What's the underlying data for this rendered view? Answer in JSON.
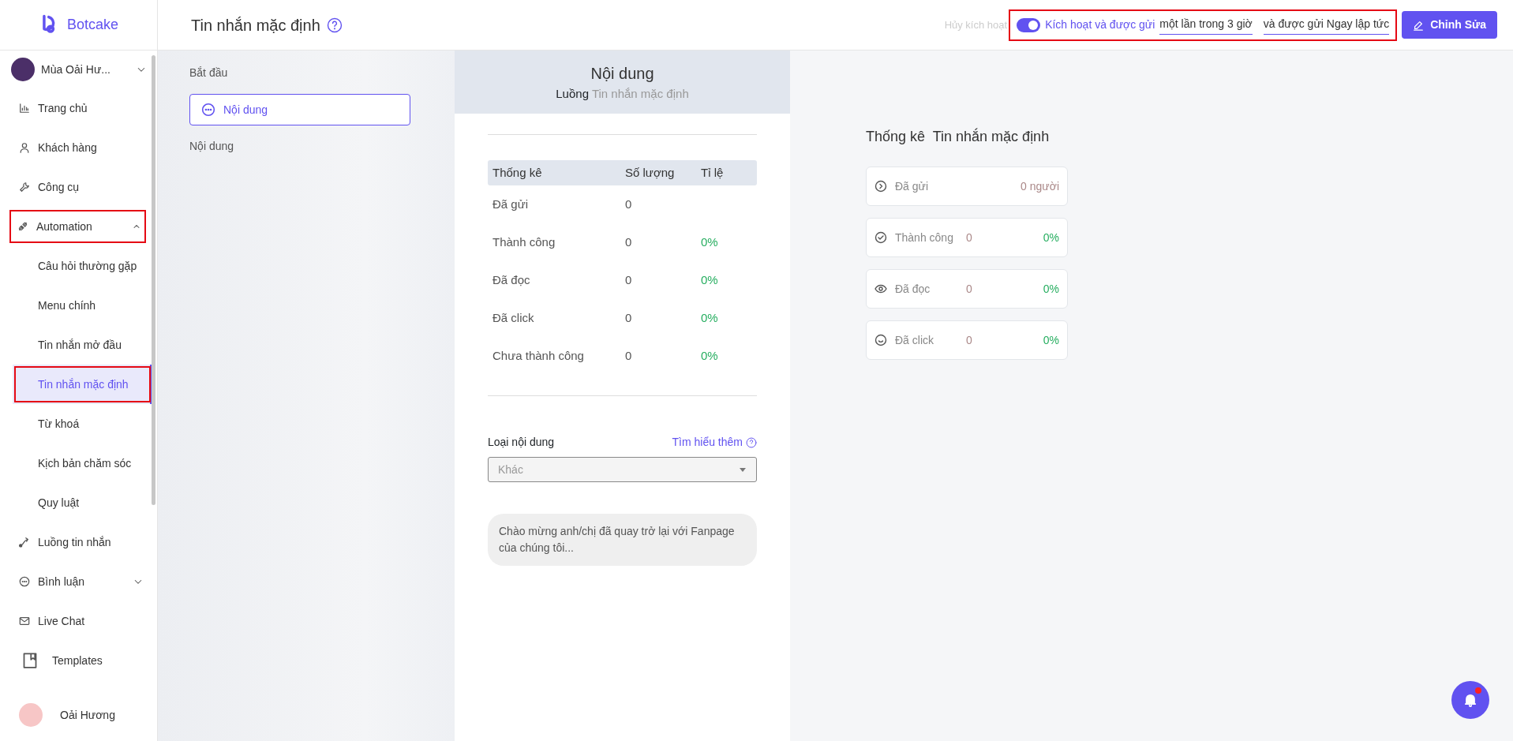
{
  "logo": {
    "text": "Botcake"
  },
  "account": {
    "name": "Mùa Oải Hư..."
  },
  "sidebar": {
    "items": [
      {
        "label": "Trang chủ"
      },
      {
        "label": "Khách hàng"
      },
      {
        "label": "Công cụ"
      },
      {
        "label": "Automation",
        "expanded": true,
        "highlighted": true,
        "children": [
          {
            "label": "Câu hỏi thường gặp",
            "selected": false,
            "highlighted": false
          },
          {
            "label": "Menu chính",
            "selected": false,
            "highlighted": false
          },
          {
            "label": "Tin nhắn mở đầu",
            "selected": false,
            "highlighted": false
          },
          {
            "label": "Tin nhắn mặc định",
            "selected": true,
            "highlighted": true
          },
          {
            "label": "Từ khoá",
            "selected": false,
            "highlighted": false
          },
          {
            "label": "Kịch bản chăm sóc",
            "selected": false,
            "highlighted": false
          },
          {
            "label": "Quy luật",
            "selected": false,
            "highlighted": false
          }
        ]
      },
      {
        "label": "Luồng tin nhắn"
      },
      {
        "label": "Bình luận",
        "expanded": false,
        "highlighted": false
      },
      {
        "label": "Live Chat"
      },
      {
        "label": "Templates"
      }
    ]
  },
  "user": {
    "name": "Oải Hương"
  },
  "header": {
    "title": "Tin nhắn mặc định",
    "deactivate_label": "Hủy kích hoạt",
    "toggle": {
      "on": true,
      "highlighted": true,
      "label": "Kích hoạt và được gửi",
      "frequency": "một lần trong 3 giờ",
      "delay": "và được gửi Ngay lập tức"
    },
    "edit_button": "Chỉnh Sửa"
  },
  "flow": {
    "start_label": "Bắt đầu",
    "node": {
      "label": "Nội dung",
      "selected": true
    },
    "step_label": "Nội dung"
  },
  "content_panel": {
    "title": "Nội dung",
    "subtitle_prefix": "Luồng",
    "subtitle": "Tin nhắn mặc định",
    "table": {
      "columns": [
        "Thống kê",
        "Số lượng",
        "Tỉ lệ"
      ],
      "rows": [
        {
          "label": "Đã gửi",
          "count": "0"
        },
        {
          "label": "Thành công",
          "count": "0",
          "rate": "0%"
        },
        {
          "label": "Đã đọc",
          "count": "0",
          "rate": "0%"
        },
        {
          "label": "Đã click",
          "count": "0",
          "rate": "0%"
        },
        {
          "label": "Chưa thành công",
          "count": "0",
          "rate": "0%"
        }
      ]
    },
    "content_type_label": "Loại nội dung",
    "learn_more": "Tìm hiểu thêm",
    "content_type": {
      "value": "Khác",
      "disabled": true
    },
    "message": "Chào mừng anh/chị đã quay trở lại với Fanpage của chúng tôi..."
  },
  "stats": {
    "title": "Thống kê",
    "subtitle": "Tin nhắn mặc định",
    "cards": [
      {
        "label": "Đã gửi",
        "count": "0 người"
      },
      {
        "label": "Thành công",
        "count": "0",
        "rate": "0%"
      },
      {
        "label": "Đã đọc",
        "count": "0",
        "rate": "0%"
      },
      {
        "label": "Đã click",
        "count": "0",
        "rate": "0%"
      }
    ]
  },
  "notifications": {
    "unread": true
  }
}
